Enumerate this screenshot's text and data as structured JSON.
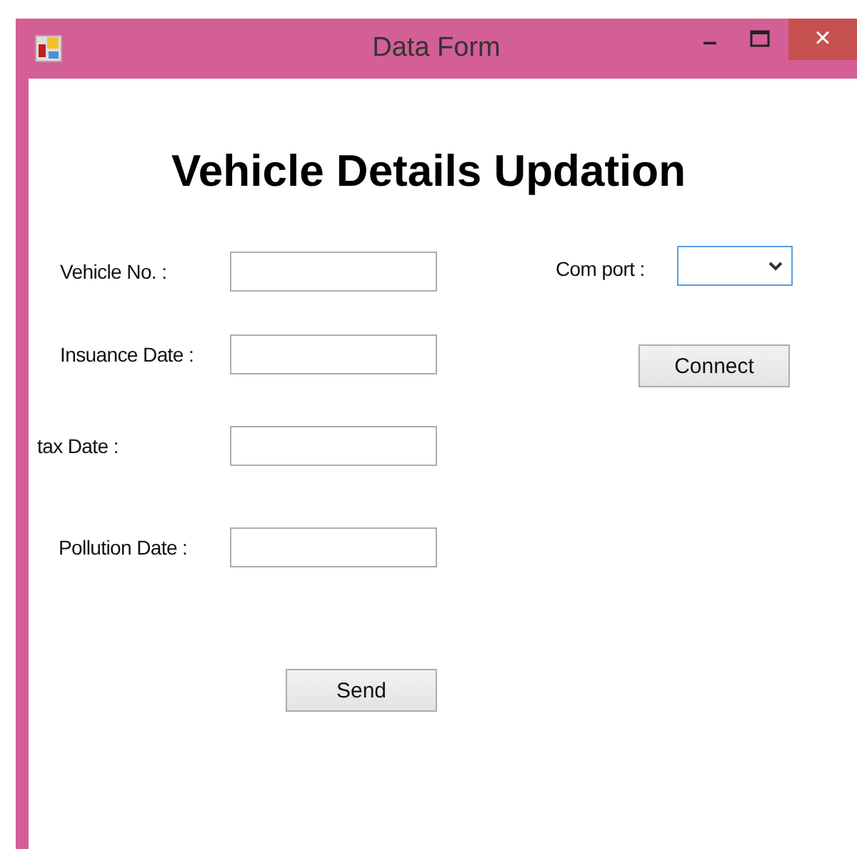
{
  "window": {
    "title": "Data Form",
    "controls": [
      "–",
      "×"
    ]
  },
  "heading": "Vehicle Details Updation",
  "fields": [
    {
      "label": "Vehicle No. :"
    },
    {
      "label": "Insuance Date :"
    },
    {
      "label": "tax Date :"
    },
    {
      "label": "Pollution Date :"
    }
  ],
  "com_port": {
    "label": "Com port :",
    "focused": true
  },
  "buttons": {
    "connect": "Connect",
    "send": "Send"
  }
}
